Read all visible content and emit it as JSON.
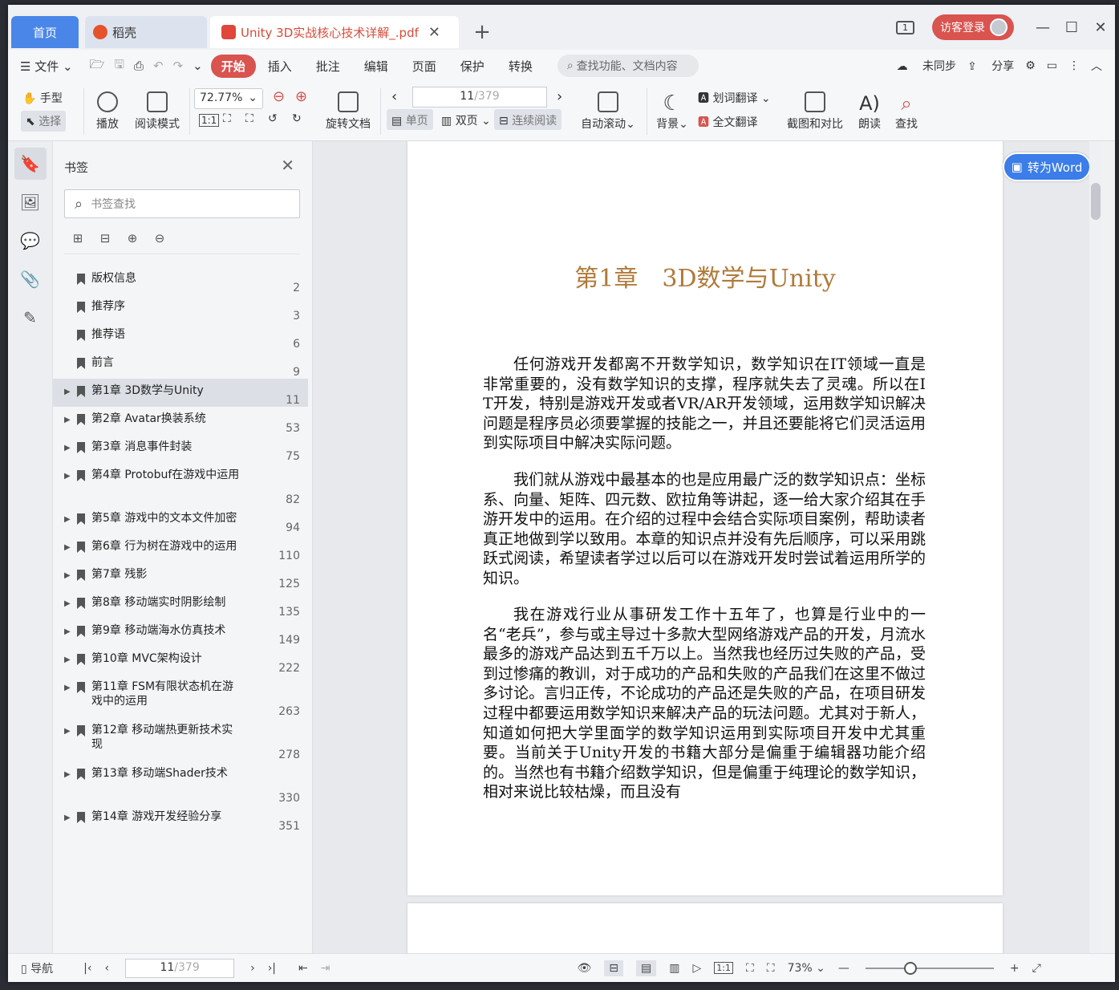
{
  "titlebar": {
    "tab_home": "首页",
    "tab_daoke": "稻壳",
    "tab_doc": "Unity 3D实战核心技术详解_.pdf",
    "visitor": "访客登录",
    "page_count_badge": "1",
    "accent": "#d9534f"
  },
  "menu": {
    "file": "文件",
    "items": [
      "开始",
      "插入",
      "批注",
      "编辑",
      "页面",
      "保护",
      "转换"
    ],
    "find_placeholder": "查找功能、文档内容",
    "sync": "未同步",
    "share": "分享"
  },
  "ribbon": {
    "hand": "手型",
    "select": "选择",
    "play": "播放",
    "read_mode": "阅读模式",
    "zoom": "72.77%",
    "rotate": "旋转文档",
    "page_current": "11",
    "page_total": "/379",
    "single": "单页",
    "double": "双页",
    "continuous": "连续阅读",
    "auto_scroll": "自动滚动",
    "background": "背景",
    "word_translate": "划词翻译",
    "full_translate": "全文翻译",
    "screenshot": "截图和对比",
    "read_aloud": "朗读",
    "search": "查找"
  },
  "panel": {
    "title": "书签",
    "search_placeholder": "书签查找",
    "bookmarks": [
      {
        "label": "版权信息",
        "page": "2",
        "expandable": false
      },
      {
        "label": "推荐序",
        "page": "3",
        "expandable": false
      },
      {
        "label": "推荐语",
        "page": "6",
        "expandable": false
      },
      {
        "label": "前言",
        "page": "9",
        "expandable": false
      },
      {
        "label": "第1章 3D数学与Unity",
        "page": "11",
        "expandable": true,
        "selected": true
      },
      {
        "label": "第2章 Avatar换装系统",
        "page": "53",
        "expandable": true
      },
      {
        "label": "第3章 消息事件封装",
        "page": "75",
        "expandable": true
      },
      {
        "label": "第4章 Protobuf在游戏中运用",
        "page": "82",
        "expandable": true
      },
      {
        "label": "第5章 游戏中的文本文件加密",
        "page": "94",
        "expandable": true
      },
      {
        "label": "第6章 行为树在游戏中的运用",
        "page": "110",
        "expandable": true
      },
      {
        "label": "第7章 残影",
        "page": "125",
        "expandable": true
      },
      {
        "label": "第8章 移动端实时阴影绘制",
        "page": "135",
        "expandable": true
      },
      {
        "label": "第9章 移动端海水仿真技术",
        "page": "149",
        "expandable": true
      },
      {
        "label": "第10章 MVC架构设计",
        "page": "222",
        "expandable": true
      },
      {
        "label": "第11章 FSM有限状态机在游戏中的运用",
        "page": "263",
        "expandable": true
      },
      {
        "label": "第12章 移动端热更新技术实现",
        "page": "278",
        "expandable": true
      },
      {
        "label": "第13章 移动端Shader技术",
        "page": "330",
        "expandable": true
      },
      {
        "label": "第14章 游戏开发经验分享",
        "page": "351",
        "expandable": true
      }
    ]
  },
  "document": {
    "chapter_title": "第1章　3D数学与Unity",
    "paragraphs": [
      "任何游戏开发都离不开数学知识，数学知识在IT领域一直是非常重要的，没有数学知识的支撑，程序就失去了灵魂。所以在IT开发，特别是游戏开发或者VR/AR开发领域，运用数学知识解决问题是程序员必须要掌握的技能之一，并且还要能将它们灵活运用到实际项目中解决实际问题。",
      "我们就从游戏中最基本的也是应用最广泛的数学知识点：坐标系、向量、矩阵、四元数、欧拉角等讲起，逐一给大家介绍其在手游开发中的运用。在介绍的过程中会结合实际项目案例，帮助读者真正地做到学以致用。本章的知识点并没有先后顺序，可以采用跳跃式阅读，希望读者学过以后可以在游戏开发时尝试着运用所学的知识。",
      "我在游戏行业从事研发工作十五年了，也算是行业中的一名“老兵”，参与或主导过十多款大型网络游戏产品的开发，月流水最多的游戏产品达到五千万以上。当然我也经历过失败的产品，受到过惨痛的教训，对于成功的产品和失败的产品我们在这里不做过多讨论。言归正传，不论成功的产品还是失败的产品，在项目研发过程中都要运用数学知识来解决产品的玩法问题。尤其对于新人，知道如何把大学里面学的数学知识运用到实际项目开发中尤其重要。当前关于Unity开发的书籍大部分是偏重于编辑器功能介绍的。当然也有书籍介绍数学知识，但是偏重于纯理论的数学知识，相对来说比较枯燥，而且没有"
    ],
    "to_word": "转为Word"
  },
  "statusbar": {
    "nav": "导航",
    "page_current": "11",
    "page_total": "/379",
    "zoom": "73%",
    "zoom_fraction": 0.35
  }
}
